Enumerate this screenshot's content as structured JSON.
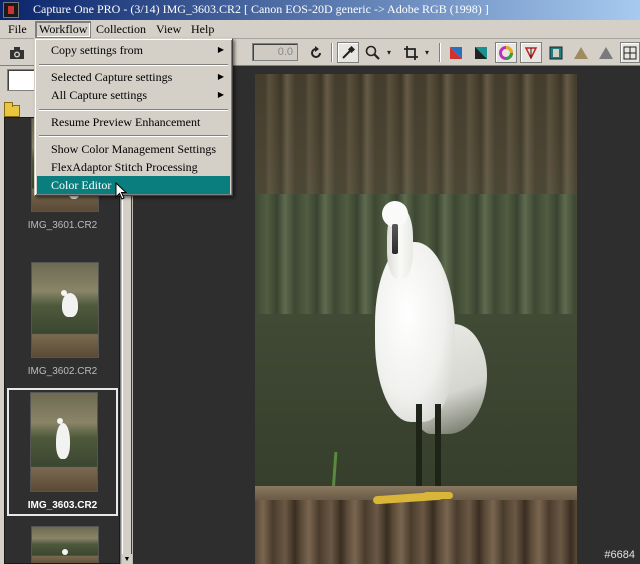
{
  "window": {
    "title": "Capture One PRO  -  (3/14) IMG_3603.CR2  [ Canon EOS-20D generic -> Adobe RGB (1998) ]"
  },
  "menubar": {
    "items": [
      {
        "label": "File"
      },
      {
        "label": "Workflow"
      },
      {
        "label": "Collection"
      },
      {
        "label": "View"
      },
      {
        "label": "Help"
      }
    ]
  },
  "toolbar": {
    "value_field": "0.0",
    "icons": [
      "camera-icon",
      "rotate-icon",
      "eyedropper-icon",
      "zoom-icon",
      "crop-icon",
      "color-balance-icon",
      "exposure-icon",
      "color-wheel-icon",
      "levels-icon",
      "panel-icon",
      "warning-icon",
      "grid-icon"
    ]
  },
  "workflow_menu": {
    "items": [
      {
        "label": "Copy settings from",
        "submenu": true
      },
      {
        "label": "Selected Capture settings",
        "submenu": true
      },
      {
        "label": "All Capture settings",
        "submenu": true
      },
      {
        "label": "Resume Preview Enhancement",
        "submenu": false
      },
      {
        "label": "Show Color Management Settings",
        "submenu": false
      },
      {
        "label": "FlexAdaptor Stitch Processing",
        "submenu": false
      },
      {
        "label": "Color Editor",
        "submenu": false,
        "highlighted": true
      }
    ],
    "submenu_arrow": "▶"
  },
  "browser": {
    "thumbnails": [
      {
        "filename": "IMG_3601.CR2",
        "selected": false
      },
      {
        "filename": "IMG_3602.CR2",
        "selected": false
      },
      {
        "filename": "IMG_3603.CR2",
        "selected": true
      }
    ]
  },
  "watermark": "#6684",
  "colors": {
    "title_gradient_start": "#0a246a",
    "menu_highlight": "#0a7e7e",
    "chrome": "#d4d0c8",
    "canvas": "#2e2e2e"
  }
}
